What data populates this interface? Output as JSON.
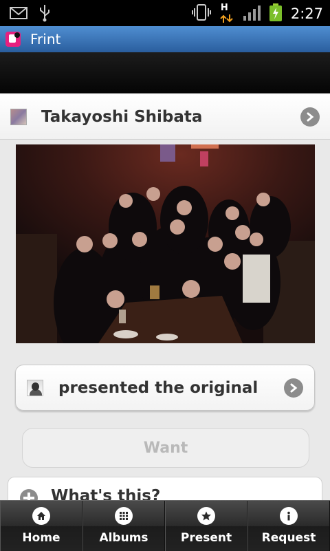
{
  "status_bar": {
    "time": "2:27",
    "network_label": "H",
    "icons": [
      "gmail-icon",
      "usb-icon",
      "vibrate-icon",
      "data-transfer-icon",
      "signal-icon",
      "battery-icon"
    ]
  },
  "app": {
    "title": "Frint",
    "icon": "frint-app-icon"
  },
  "profile": {
    "name": "Takayoshi Shibata"
  },
  "photo": {
    "description_icon": "group-photo"
  },
  "presented": {
    "label": "presented the original"
  },
  "want": {
    "label": "Want"
  },
  "whats_this": {
    "label": "What's this?"
  },
  "tabs": [
    {
      "label": "Home",
      "icon": "home-icon"
    },
    {
      "label": "Albums",
      "icon": "grid-icon"
    },
    {
      "label": "Present",
      "icon": "star-icon"
    },
    {
      "label": "Request",
      "icon": "info-icon"
    }
  ],
  "colors": {
    "title_bar": "#2a5e9e",
    "app_icon": "#e8207f",
    "want_disabled_text": "#b9b9b9"
  }
}
